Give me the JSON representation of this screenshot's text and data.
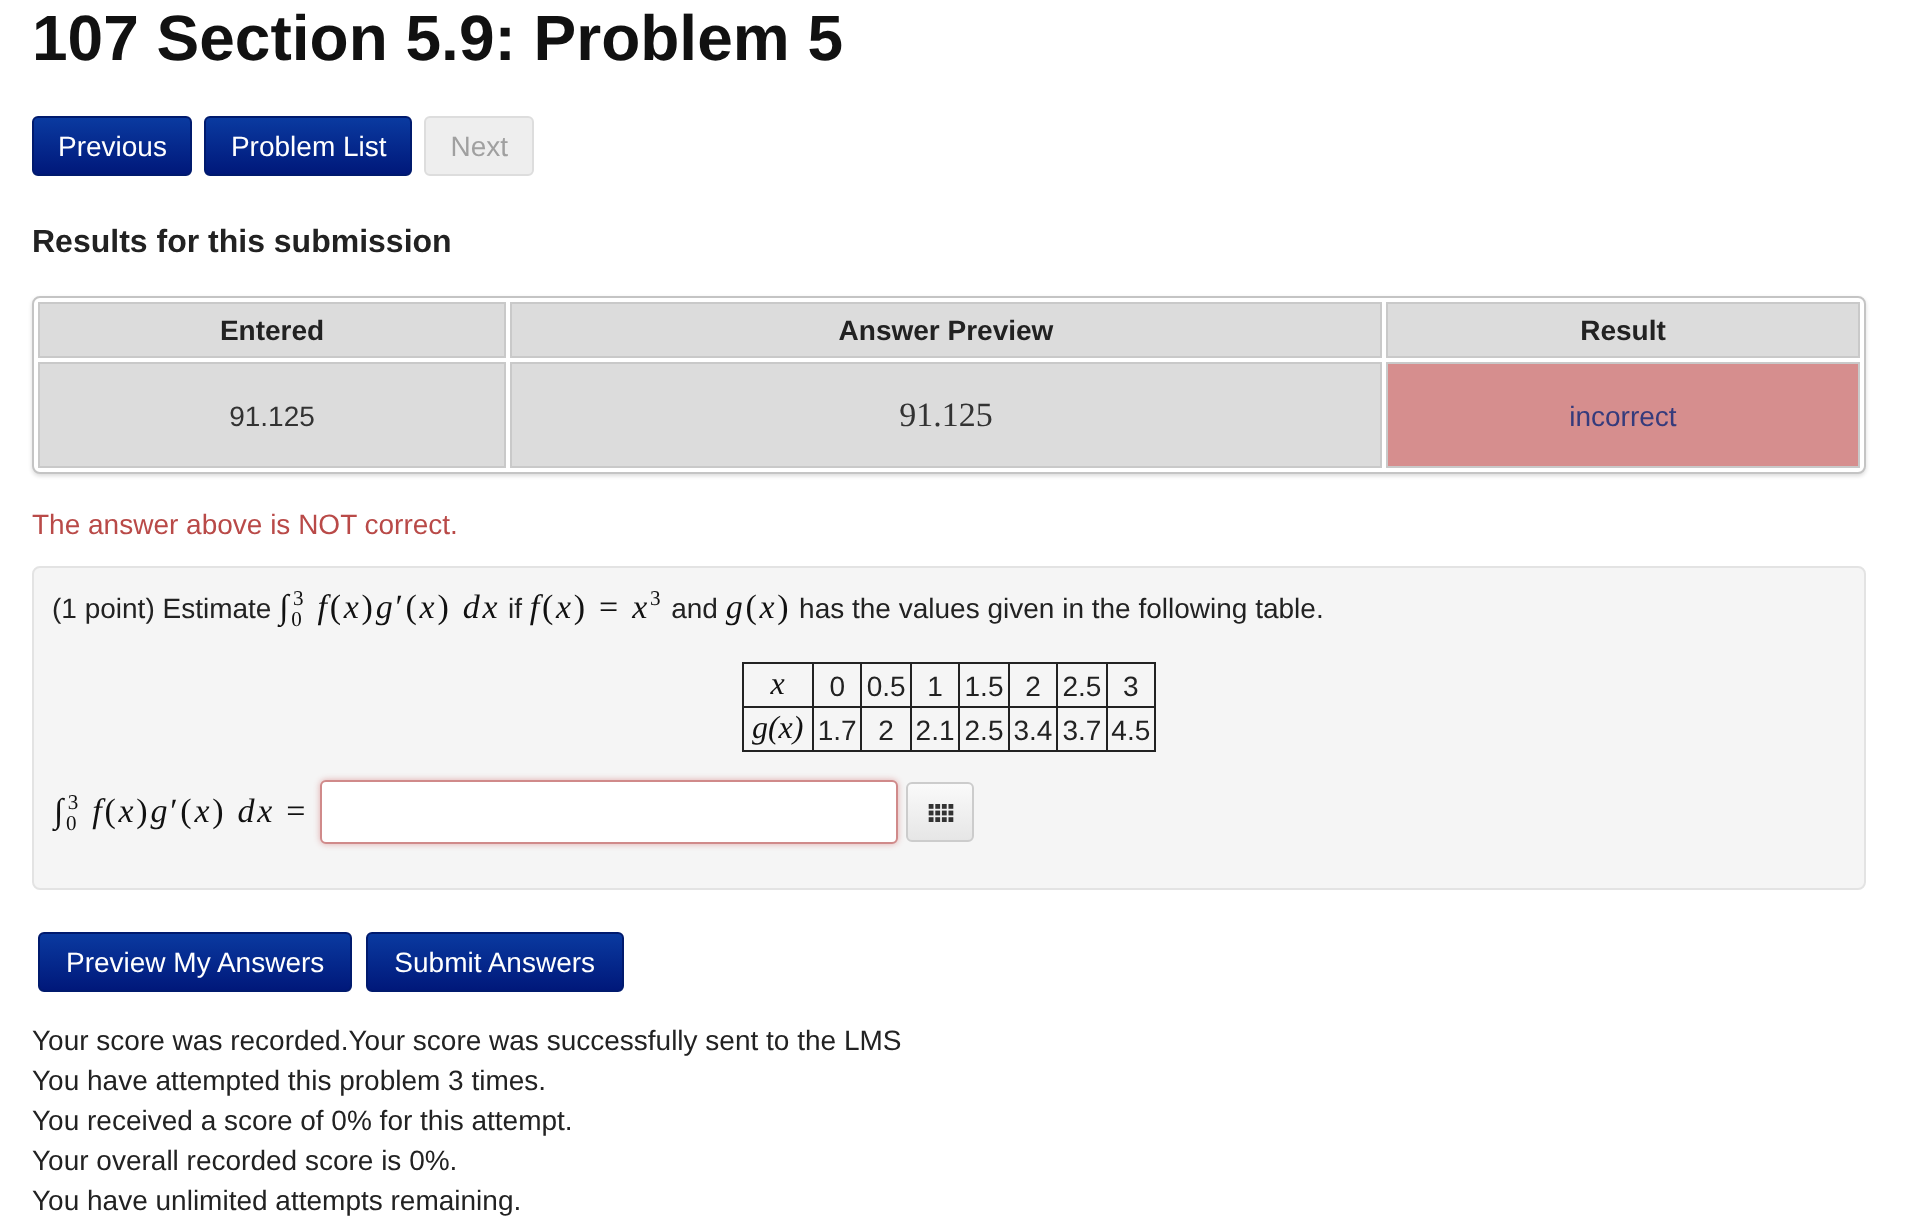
{
  "page": {
    "title": "107 Section 5.9: Problem 5"
  },
  "nav_buttons": [
    {
      "label": "Previous",
      "disabled": false
    },
    {
      "label": "Problem List",
      "disabled": false
    },
    {
      "label": "Next",
      "disabled": true
    }
  ],
  "results": {
    "heading": "Results for this submission",
    "columns": [
      "Entered",
      "Answer Preview",
      "Result"
    ],
    "rows": [
      {
        "entered": "91.125",
        "answer_preview": "91.125",
        "result": "incorrect",
        "correct": false
      }
    ]
  },
  "feedback": "The answer above is NOT correct.",
  "problem": {
    "statement": [
      {
        "kind": "text",
        "text": "(1 point) Estimate"
      },
      {
        "kind": "math",
        "text": "∫$_{0}$$^{3}$ *f*(*x*)*g*′(*x*) *dx*"
      },
      {
        "kind": "text",
        "text": "if"
      },
      {
        "kind": "math",
        "text": "*f*(*x*) = *x*$^{3}$"
      },
      {
        "kind": "text",
        "text": "and"
      },
      {
        "kind": "math",
        "text": "*g*(*x*)"
      },
      {
        "kind": "text",
        "text": "has the values given in the following table."
      }
    ],
    "values_table": {
      "rows": [
        {
          "label": "x",
          "values": [
            "0",
            "0.5",
            "1",
            "1.5",
            "2",
            "2.5",
            "3"
          ]
        },
        {
          "label": "g(x)",
          "values": [
            "1.7",
            "2",
            "2.1",
            "2.5",
            "3.4",
            "3.7",
            "4.5"
          ]
        }
      ]
    },
    "answer": {
      "label": "∫$_{0}$$^{3}$ *f*(*x*)*g*′(*x*) *dx* ="
    }
  },
  "action_buttons": [
    "Preview My Answers",
    "Submit Answers"
  ],
  "score_messages": [
    "Your score was recorded.Your score was successfully sent to the LMS",
    "You have attempted this problem 3 times.",
    "You received a score of 0% for this attempt.",
    "Your overall recorded score is 0%.",
    "You have unlimited attempts remaining."
  ]
}
